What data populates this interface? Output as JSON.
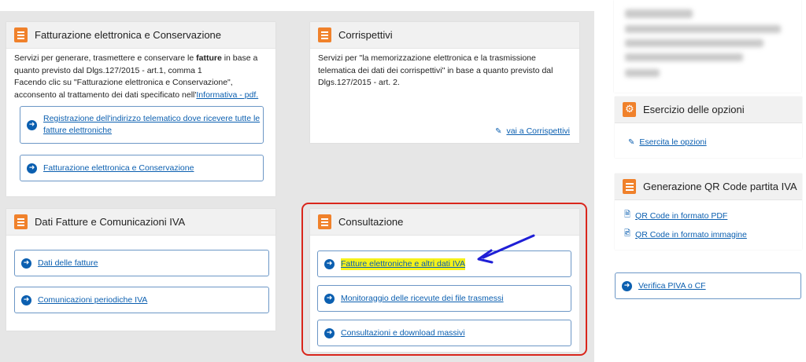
{
  "fatturazione": {
    "title": "Fatturazione elettronica e Conservazione",
    "text1": "Servizi per generare, trasmettere e conservare le ",
    "text_bold": "fatture",
    "text2": " in base a quanto previsto dal Dlgs.127/2015 - art.1, comma 1",
    "text3": "Facendo clic su \"Fatturazione elettronica e Conservazione\", acconsento al trattamento dei dati specificato nell'",
    "informativa_link": "Informativa - pdf.",
    "btn_registrazione": "Registrazione dell'indirizzo telematico dove ricevere tutte le fatture elettroniche",
    "btn_fatturazione": "Fatturazione elettronica e Conservazione"
  },
  "corrispettivi": {
    "title": "Corrispettivi",
    "text": "Servizi per \"la memorizzazione elettronica e la trasmissione telematica dei dati dei corrispettivi\" in base a quanto previsto dal Dlgs.127/2015 - art. 2.",
    "link": "vai a Corrispettivi"
  },
  "dati_fatture": {
    "title": "Dati Fatture e Comunicazioni IVA",
    "btn_dati": "Dati delle fatture",
    "btn_comunicazioni": "Comunicazioni periodiche IVA"
  },
  "consultazione": {
    "title": "Consultazione",
    "btn_fatture": "Fatture elettroniche e altri dati IVA",
    "btn_monitoraggio": "Monitoraggio delle ricevute dei file trasmessi",
    "btn_download": "Consultazioni e download massivi"
  },
  "esercizio": {
    "title": "Esercizio delle opzioni",
    "link": "Esercita le opzioni"
  },
  "qrcode": {
    "title": "Generazione QR Code partita IVA",
    "link_pdf": "QR Code in formato PDF",
    "link_img": "QR Code in formato immagine"
  },
  "verifica": {
    "label": "Verifica PIVA o CF"
  },
  "colors": {
    "accent_orange": "#f0812b",
    "link_blue": "#0b5fb0",
    "highlight_yellow": "#f4f11a",
    "annotation_red": "#d9261c",
    "annotation_arrow_blue": "#1f1fd6"
  }
}
